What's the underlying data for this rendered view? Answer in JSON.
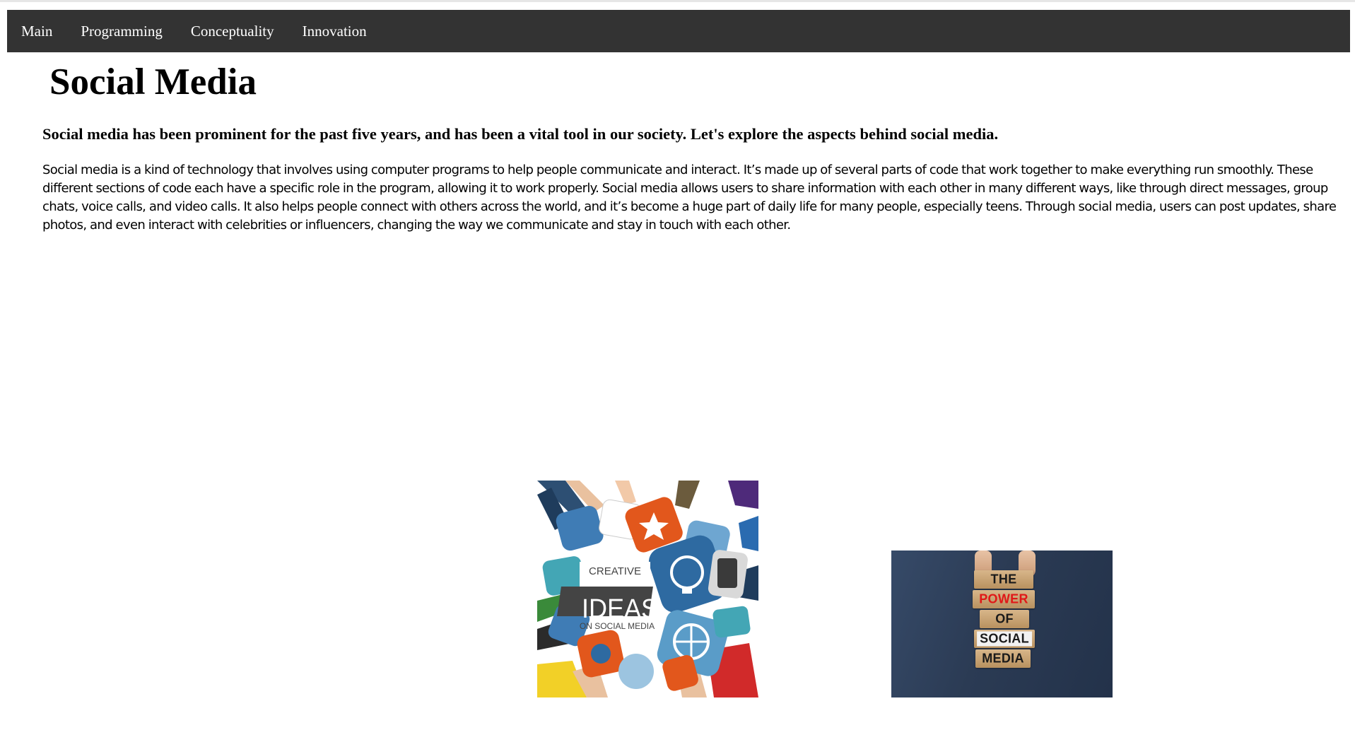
{
  "nav": {
    "items": [
      {
        "label": "Main"
      },
      {
        "label": "Programming"
      },
      {
        "label": "Conceptuality"
      },
      {
        "label": "Innovation"
      }
    ]
  },
  "page": {
    "title": "Social Media",
    "lead": "Social media has been prominent for the past five years, and has been a vital tool in our society. Let's explore the aspects behind social media.",
    "body": "Social media is a kind of technology that involves using computer programs to help people communicate and interact. It’s made up of several parts of code that work together to make everything run smoothly. These different sections of code each have a specific role in the program, allowing it to work properly. Social media allows users to share information with each other in many different ways, like through direct messages, group chats, voice calls, and video calls. It also helps people connect with others across the world, and it’s become a huge part of daily life for many people, especially teens. Through social media, users can post updates, share photos, and even interact with celebrities or influencers, changing the way we communicate and stay in touch with each other."
  },
  "images": {
    "ideas": {
      "line1": "CREATIVE",
      "line2": "IDEAS",
      "line3": "ON SOCIAL MEDIA"
    },
    "power": {
      "blocks": [
        "THE",
        "POWER",
        "OF",
        "SOCIAL",
        "MEDIA"
      ]
    }
  },
  "colors": {
    "navbar": "#333333",
    "nav_text": "#ffffff",
    "power_accent": "#e01818",
    "power_background": "#2b3b54"
  }
}
